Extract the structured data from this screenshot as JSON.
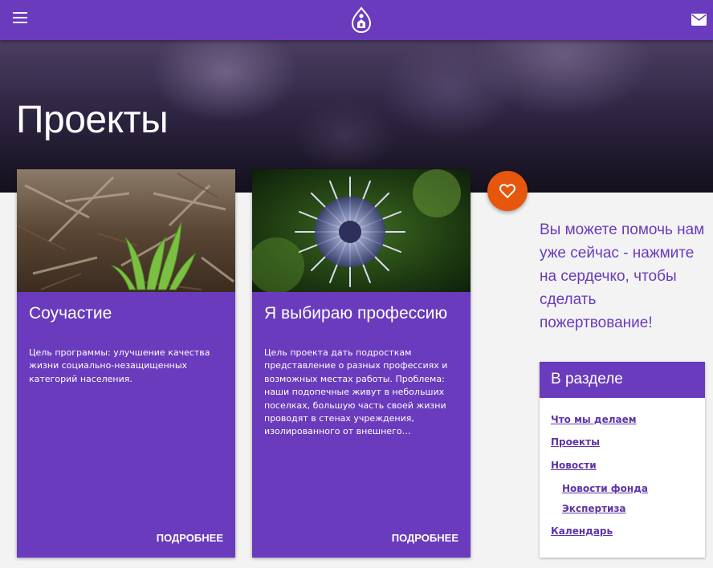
{
  "header": {
    "menu_icon": "hamburger-menu-icon",
    "logo_icon": "hand-drop-logo-icon",
    "mail_icon": "envelope-icon",
    "brand_color": "#6a3bbd"
  },
  "hero": {
    "title": "Проекты"
  },
  "projects": [
    {
      "title": "Соучастие",
      "description": "Цель программы: улучшение качества жизни социально-незащищенных категорий населения.",
      "more_label": "ПОДРОБНЕЕ"
    },
    {
      "title": "Я выбираю профессию",
      "description": "Цель проекта дать подросткам представление о разных профессиях и возможных местах работы. Проблема: наши подопечные живут в небольших поселках, большую часть своей жизни проводят в стенах учреждения, изолированного от внешнего…",
      "more_label": "ПОДРОБНЕЕ"
    }
  ],
  "donate": {
    "icon": "heart-icon",
    "accent_color": "#e6570d",
    "text": "Вы можете помочь нам уже сейчас - нажмите на сердечко, чтобы сделать пожертвование!"
  },
  "section": {
    "title": "В разделе",
    "links": [
      {
        "label": "Что мы делаем"
      },
      {
        "label": "Проекты"
      },
      {
        "label": "Новости"
      },
      {
        "label": "Новости фонда"
      },
      {
        "label": "Экспертиза"
      },
      {
        "label": "Календарь"
      }
    ]
  }
}
